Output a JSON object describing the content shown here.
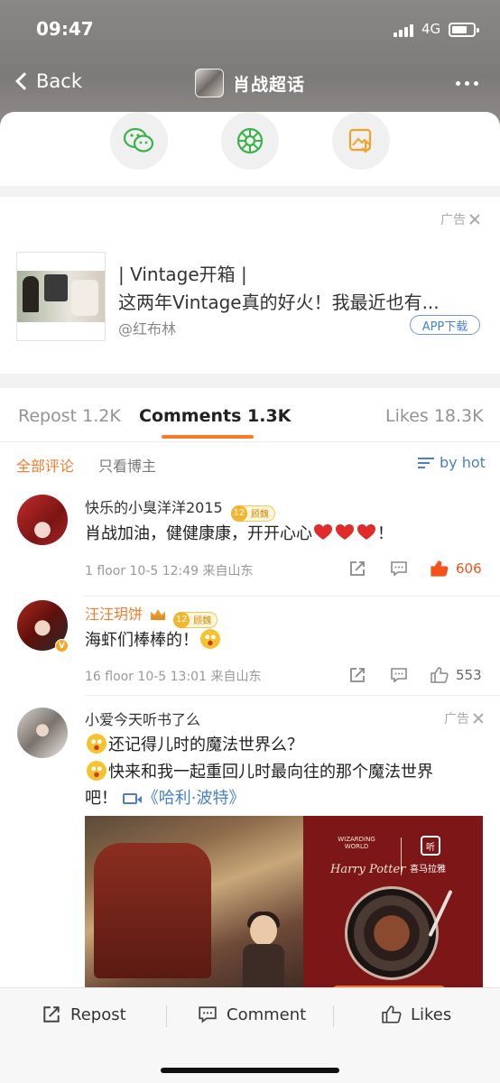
{
  "status": {
    "time": "09:47",
    "network": "4G"
  },
  "nav": {
    "back_label": "Back",
    "topic_title": "肖战超话"
  },
  "ad_card": {
    "ad_label": "广告",
    "title": "| Vintage开箱 |",
    "description": "这两年Vintage真的好火！我最近也有...",
    "author": "@红布林",
    "download_label": "APP下载"
  },
  "tabs": {
    "repost": "Repost 1.2K",
    "comments": "Comments 1.3K",
    "likes": "Likes 18.3K"
  },
  "filters": {
    "all": "全部评论",
    "owner_only": "只看博主",
    "sort": "by hot"
  },
  "comments": [
    {
      "user": "快乐的小臭洋洋2015",
      "level_num": "12",
      "level_label": "顾魏",
      "text": "肖战加油，健健康康，开开心心",
      "text_end": "！",
      "meta": "1 floor 10-5 12:49 来自山东",
      "likes": "606"
    },
    {
      "user": "汪汪玥饼",
      "level_num": "12",
      "level_label": "顾魏",
      "text": "海虾们棒棒的！",
      "meta": "16 floor 10-5 13:01 来自山东",
      "likes": "553"
    },
    {
      "user": "小爱今天听书了么",
      "ad_label": "广告",
      "line1": "还记得儿时的魔法世界么？",
      "line2": "快来和我一起重回儿时最向往的那个魔法世界",
      "line3": "吧！",
      "link": "《哈利·波特》"
    }
  ],
  "banner": {
    "harry_potter": "Harry Potter",
    "wizarding": "WIZARDING WORLD",
    "app_icon": "听",
    "app_name": "喜马拉雅"
  },
  "bottom_bar": {
    "repost": "Repost",
    "comment": "Comment",
    "likes": "Likes"
  },
  "colors": {
    "accent": "#f47c2c",
    "link": "#4a7fc7",
    "like_hot": "#f4531c"
  }
}
